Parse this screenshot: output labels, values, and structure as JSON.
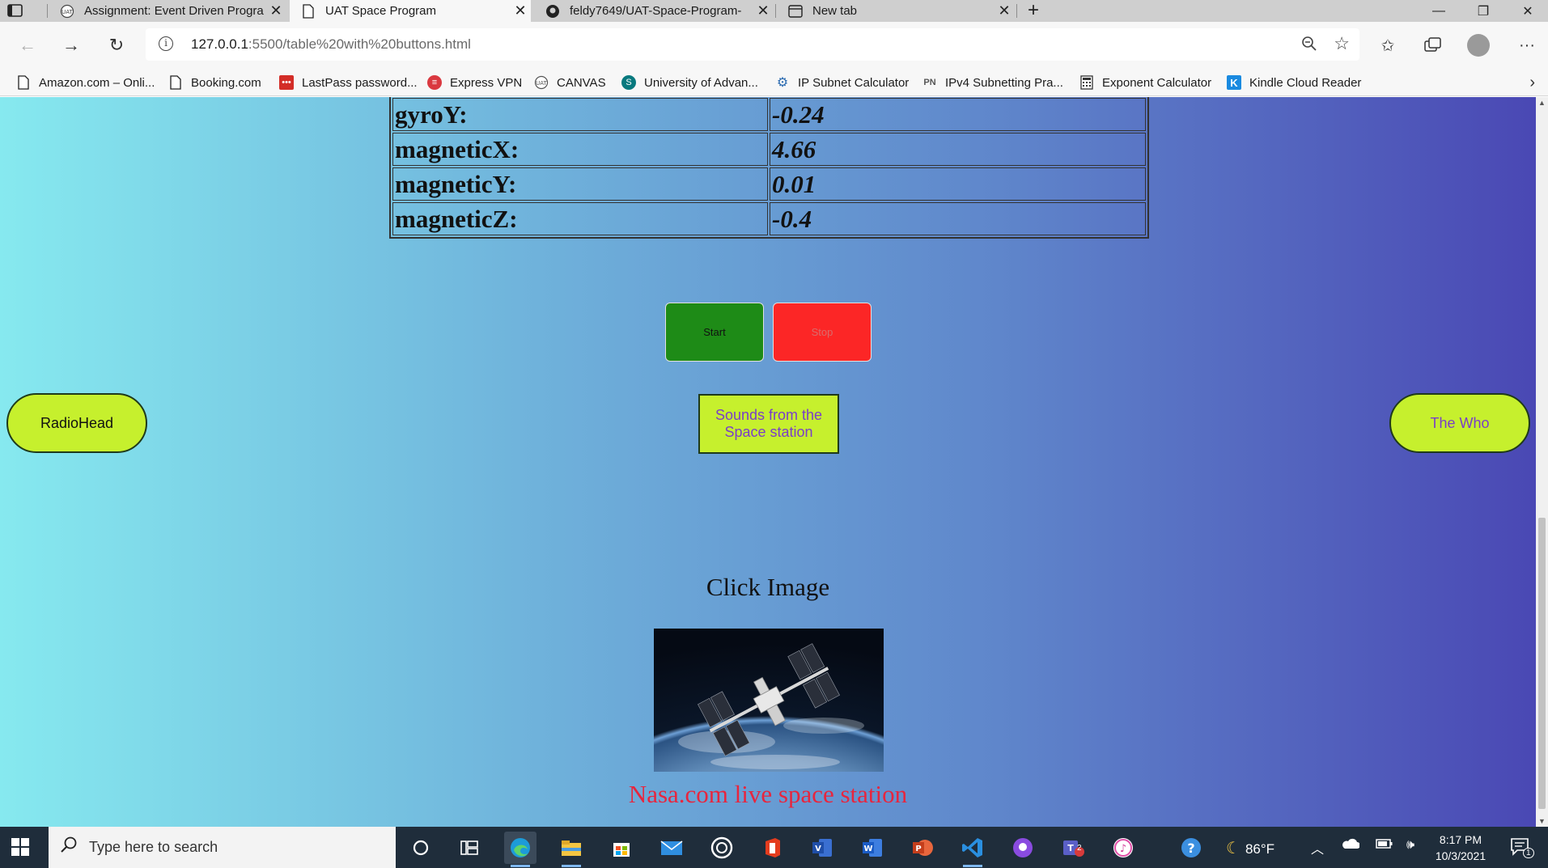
{
  "browser": {
    "tabs": [
      {
        "title": "Assignment: Event Driven Progra",
        "icon": "canvas-icon",
        "active": false
      },
      {
        "title": "UAT Space Program",
        "icon": "page-icon",
        "active": true
      },
      {
        "title": "feldy7649/UAT-Space-Program-",
        "icon": "github-icon",
        "active": false
      },
      {
        "title": "New tab",
        "icon": "new-tab-icon",
        "active": false
      }
    ],
    "url_host": "127.0.0.1",
    "url_rest": ":5500/table%20with%20buttons.html",
    "bookmarks": [
      {
        "label": "Amazon.com – Onli...",
        "icon": "page-icon"
      },
      {
        "label": "Booking.com",
        "icon": "page-icon"
      },
      {
        "label": "LastPass password...",
        "icon": "lastpass-icon"
      },
      {
        "label": "Express VPN",
        "icon": "expressvpn-icon"
      },
      {
        "label": "CANVAS",
        "icon": "canvas-icon"
      },
      {
        "label": "University of Advan...",
        "icon": "sharepoint-icon"
      },
      {
        "label": "IP Subnet Calculator",
        "icon": "gear-icon"
      },
      {
        "label": "IPv4 Subnetting Pra...",
        "icon": "network-icon"
      },
      {
        "label": "Exponent Calculator",
        "icon": "calculator-icon"
      },
      {
        "label": "Kindle Cloud Reader",
        "icon": "kindle-icon"
      }
    ]
  },
  "page": {
    "table_rows": [
      {
        "key": "gyroY:",
        "value": "-0.24"
      },
      {
        "key": "magneticX:",
        "value": "4.66"
      },
      {
        "key": "magneticY:",
        "value": "0.01"
      },
      {
        "key": "magneticZ:",
        "value": "-0.4"
      }
    ],
    "start_label": "Start",
    "stop_label": "Stop",
    "radiohead_label": "RadioHead",
    "sounds_label": "Sounds from the Space station",
    "thewho_label": "The Who",
    "click_image_heading": "Click Image",
    "nasa_link": "Nasa.com live space station"
  },
  "taskbar": {
    "search_placeholder": "Type here to search",
    "weather_temp": "86°F",
    "time": "8:17 PM",
    "date": "10/3/2021",
    "notification_count": "1",
    "teams_badge": "2"
  },
  "colors": {
    "button_green": "#1e8b17",
    "button_red": "#fc2626",
    "pill_lime": "#c6f02d",
    "link_red": "#e8253d"
  }
}
